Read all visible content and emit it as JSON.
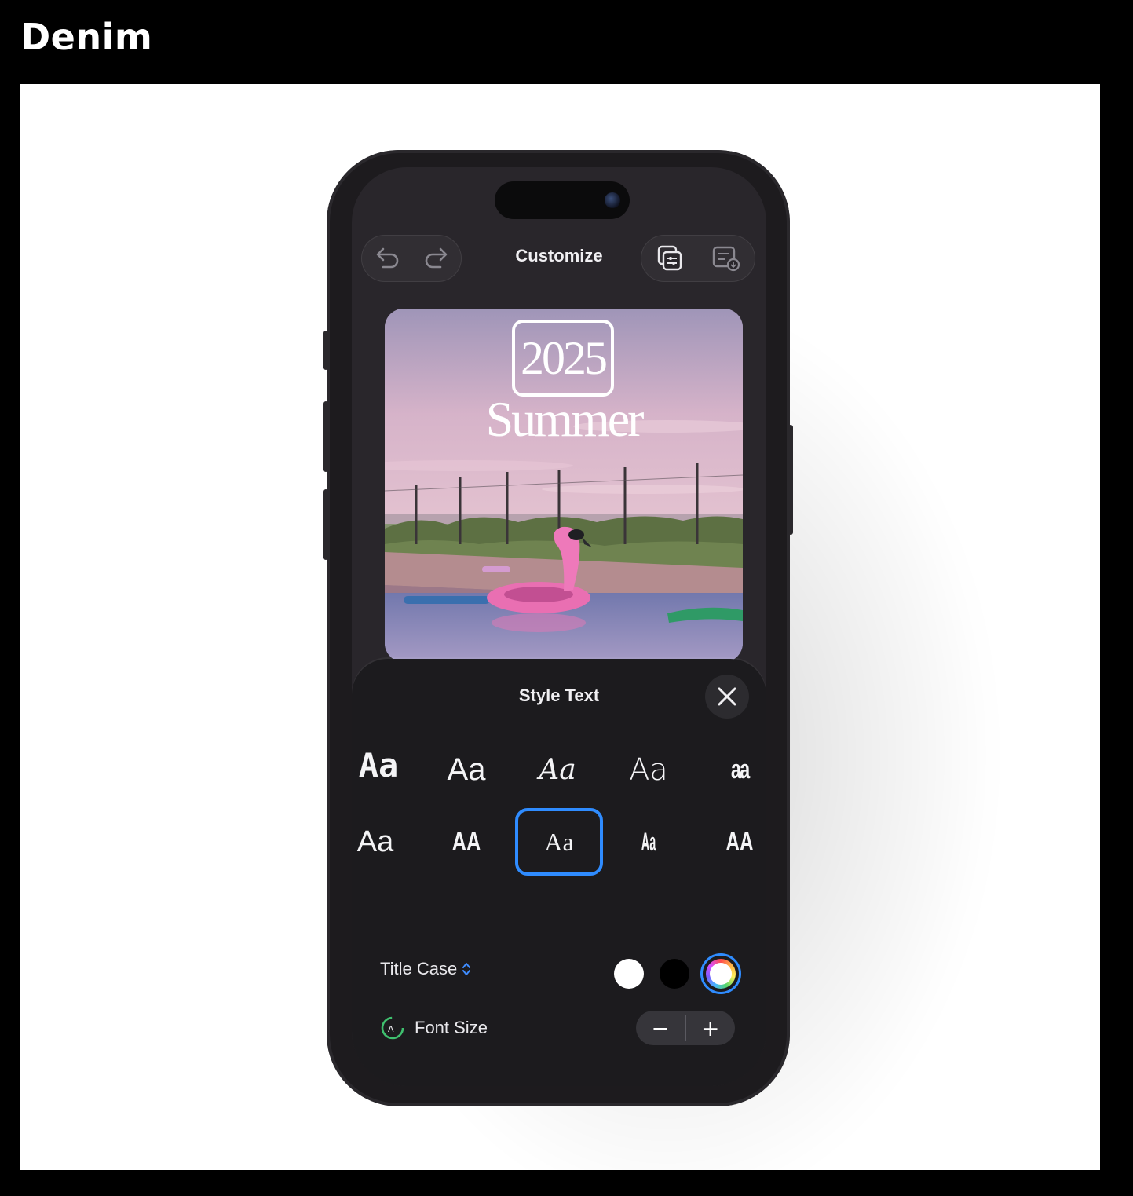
{
  "page": {
    "heading": "Denim"
  },
  "toolbar": {
    "title": "Customize",
    "undo_icon": "undo-icon",
    "redo_icon": "redo-icon",
    "copy_style_icon": "copy-style-icon",
    "save_style_icon": "save-style-icon"
  },
  "poster": {
    "year": "2025",
    "word": "Summer"
  },
  "style_sheet": {
    "title": "Style Text",
    "close_icon": "close-icon",
    "fonts": [
      {
        "label": "Aa",
        "style": "pixel-bold"
      },
      {
        "label": "Aa",
        "style": "rounded-sans"
      },
      {
        "label": "Aa",
        "style": "script"
      },
      {
        "label": "Aa",
        "style": "geometric-sans"
      },
      {
        "label": "aa",
        "style": "condensed-heavy"
      },
      {
        "label": "Aa",
        "style": "sans"
      },
      {
        "label": "AA",
        "style": "bold-condensed"
      },
      {
        "label": "Aa",
        "style": "serif",
        "selected": true
      },
      {
        "label": "Aa",
        "style": "ultra-condensed"
      },
      {
        "label": "AA",
        "style": "heavy-condensed"
      }
    ],
    "case_label": "Title Case",
    "colors": [
      "#ffffff",
      "#000000",
      "multicolor"
    ],
    "selected_color": "multicolor",
    "font_size_label": "Font Size",
    "minus": "−",
    "plus": "+"
  },
  "colors": {
    "accent": "#2f8cff",
    "sheet_bg": "#1c1b1e",
    "screen_bg": "#29262b"
  }
}
